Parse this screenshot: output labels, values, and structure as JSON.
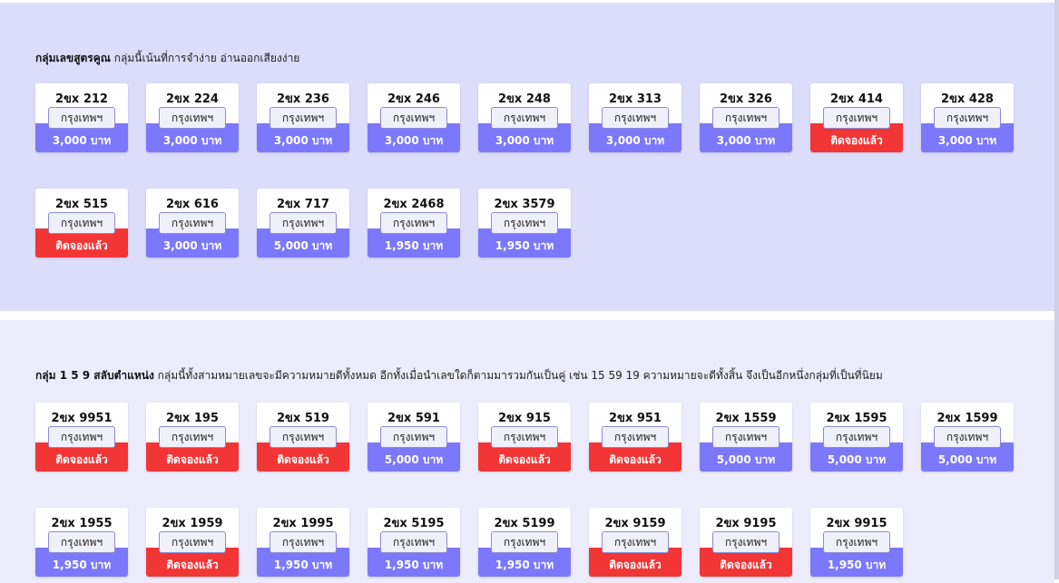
{
  "colors": {
    "available": "#7b78fb",
    "reserved": "#f23535"
  },
  "province_label": "กรุงเทพฯ",
  "section1": {
    "title": "กลุ่มเลขสูตรคูณ",
    "description": "กลุ่มนี้เน้นที่การจำง่าย อ่านออกเสียงง่าย",
    "plates": [
      {
        "number": "2ขx 212",
        "price": "3,000 บาท",
        "status": "available"
      },
      {
        "number": "2ขx 224",
        "price": "3,000 บาท",
        "status": "available"
      },
      {
        "number": "2ขx 236",
        "price": "3,000 บาท",
        "status": "available"
      },
      {
        "number": "2ขx 246",
        "price": "3,000 บาท",
        "status": "available"
      },
      {
        "number": "2ขx 248",
        "price": "3,000 บาท",
        "status": "available"
      },
      {
        "number": "2ขx 313",
        "price": "3,000 บาท",
        "status": "available"
      },
      {
        "number": "2ขx 326",
        "price": "3,000 บาท",
        "status": "available"
      },
      {
        "number": "2ขx 414",
        "price": "ติดจองแล้ว",
        "status": "reserved"
      },
      {
        "number": "2ขx 428",
        "price": "3,000 บาท",
        "status": "available"
      },
      {
        "number": "2ขx 515",
        "price": "ติดจองแล้ว",
        "status": "reserved"
      },
      {
        "number": "2ขx 616",
        "price": "3,000 บาท",
        "status": "available"
      },
      {
        "number": "2ขx 717",
        "price": "5,000 บาท",
        "status": "available"
      },
      {
        "number": "2ขx 2468",
        "price": "1,950 บาท",
        "status": "available"
      },
      {
        "number": "2ขx 3579",
        "price": "1,950 บาท",
        "status": "available"
      }
    ]
  },
  "section2": {
    "title": "กลุ่ม 1 5 9 สลับตำแหน่ง",
    "description": "กลุ่มนี้ทั้งสามหมายเลขจะมีความหมายดีทั้งหมด อีกทั้งเมื่อนำเลขใดก็ตามมารวมกันเป็นคู่ เช่น 15 59 19 ความหมายจะดีทั้งสิ้น จึงเป็นอีกหนึ่งกลุ่มที่เป็นที่นิยม",
    "plates": [
      {
        "number": "2ขx 9951",
        "price": "ติดจองแล้ว",
        "status": "reserved"
      },
      {
        "number": "2ขx 195",
        "price": "ติดจองแล้ว",
        "status": "reserved"
      },
      {
        "number": "2ขx 519",
        "price": "ติดจองแล้ว",
        "status": "reserved"
      },
      {
        "number": "2ขx 591",
        "price": "5,000 บาท",
        "status": "available"
      },
      {
        "number": "2ขx 915",
        "price": "ติดจองแล้ว",
        "status": "reserved"
      },
      {
        "number": "2ขx 951",
        "price": "ติดจองแล้ว",
        "status": "reserved"
      },
      {
        "number": "2ขx 1559",
        "price": "5,000 บาท",
        "status": "available"
      },
      {
        "number": "2ขx 1595",
        "price": "5,000 บาท",
        "status": "available"
      },
      {
        "number": "2ขx 1599",
        "price": "5,000 บาท",
        "status": "available"
      },
      {
        "number": "2ขx 1955",
        "price": "1,950 บาท",
        "status": "available"
      },
      {
        "number": "2ขx 1959",
        "price": "ติดจองแล้ว",
        "status": "reserved"
      },
      {
        "number": "2ขx 1995",
        "price": "1,950 บาท",
        "status": "available"
      },
      {
        "number": "2ขx 5195",
        "price": "1,950 บาท",
        "status": "available"
      },
      {
        "number": "2ขx 5199",
        "price": "1,950 บาท",
        "status": "available"
      },
      {
        "number": "2ขx 9159",
        "price": "ติดจองแล้ว",
        "status": "reserved"
      },
      {
        "number": "2ขx 9195",
        "price": "ติดจองแล้ว",
        "status": "reserved"
      },
      {
        "number": "2ขx 9915",
        "price": "1,950 บาท",
        "status": "available"
      }
    ]
  }
}
